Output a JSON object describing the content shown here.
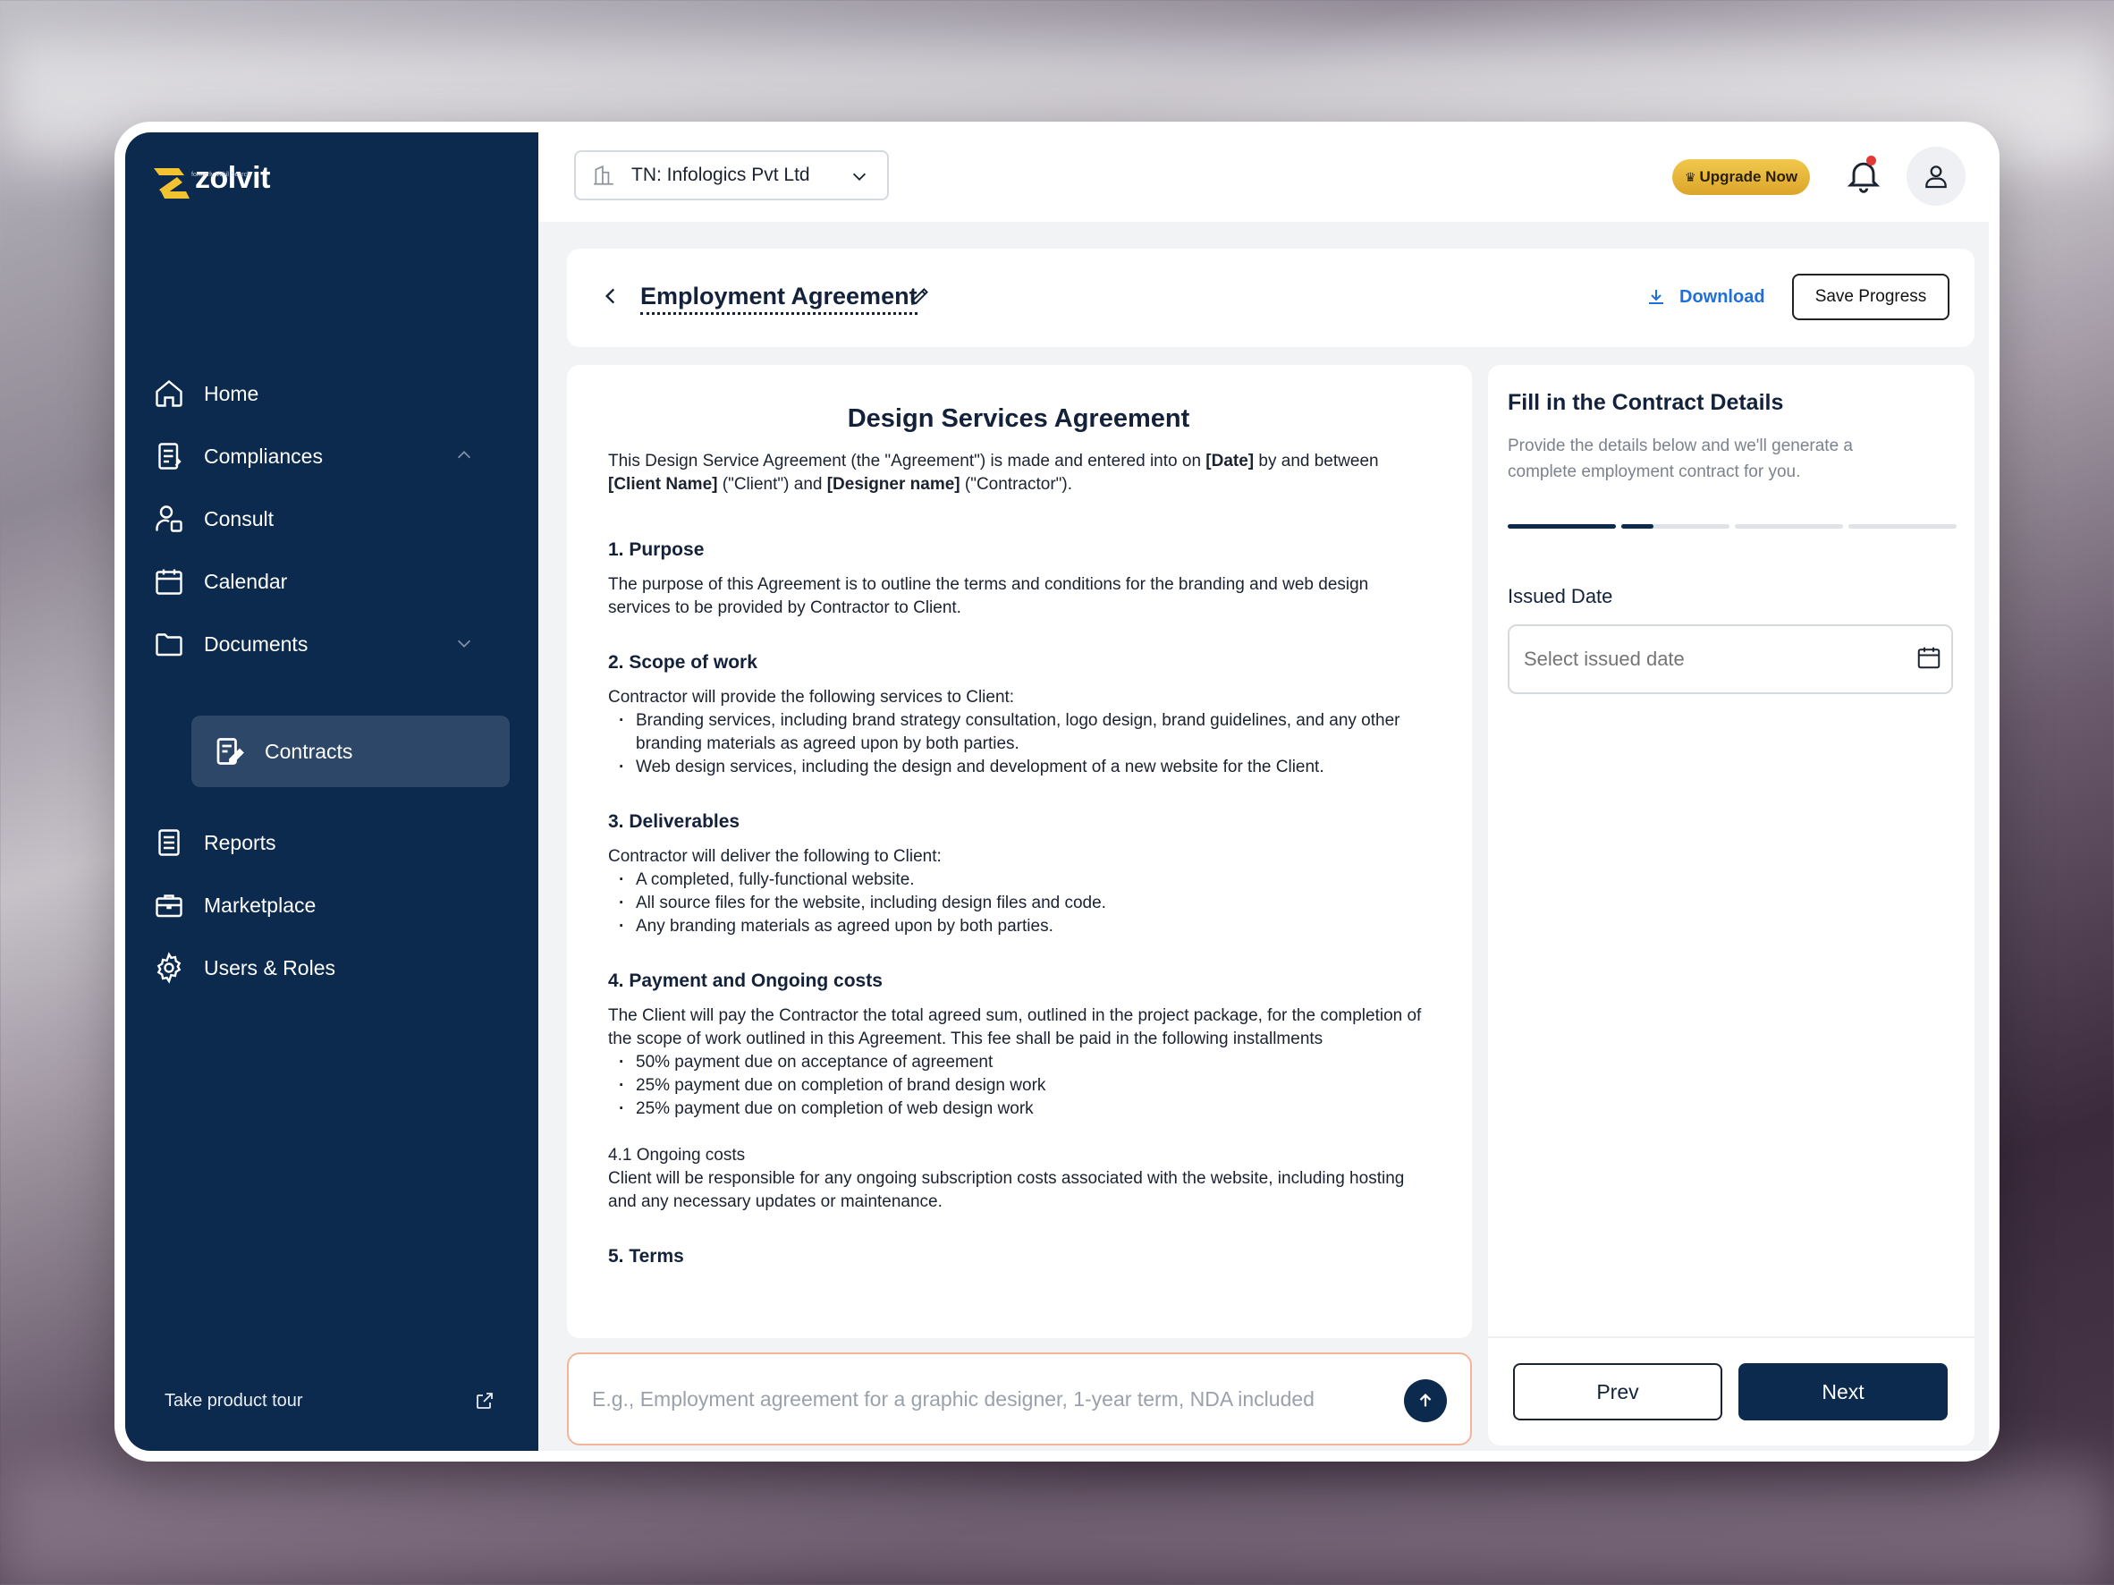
{
  "brand": {
    "name": "zolvit",
    "tagline": "formerly Vakil Search",
    "accent": "#f2c230",
    "primary": "#0b2a4d"
  },
  "sidebar": {
    "items": [
      {
        "label": "Home",
        "icon": "home-icon"
      },
      {
        "label": "Compliances",
        "icon": "clipboard-icon",
        "chevron": "chevron-up-icon"
      },
      {
        "label": "Consult",
        "icon": "consult-icon"
      },
      {
        "label": "Calendar",
        "icon": "calendar-icon"
      },
      {
        "label": "Documents",
        "icon": "folder-icon",
        "chevron": "chevron-down-icon"
      },
      {
        "label": "Reports",
        "icon": "report-icon"
      },
      {
        "label": "Marketplace",
        "icon": "briefcase-icon"
      },
      {
        "label": "Users & Roles",
        "icon": "gear-icon"
      }
    ],
    "sub_item": {
      "label": "Contracts",
      "icon": "contract-edit-icon"
    },
    "tour": {
      "label": "Take product tour",
      "icon": "external-link-icon"
    }
  },
  "topbar": {
    "company": "TN: Infologics Pvt Ltd",
    "upgrade_label": "Upgrade Now"
  },
  "header": {
    "title": "Employment Agreement",
    "download_label": "Download",
    "save_label": "Save Progress"
  },
  "document": {
    "title": "Design Services Agreement",
    "intro_a": "This Design Service Agreement (the \"Agreement\") is made and entered into on ",
    "intro_date": "[Date]",
    "intro_b": " by and between ",
    "intro_client": "[Client Name]",
    "intro_c": " (\"Client\") and ",
    "intro_designer": "[Designer name]",
    "intro_d": " (\"Contractor\").",
    "s1_title": "1. Purpose",
    "s1_text": "The purpose of this Agreement is to outline the terms and conditions for the branding and web design services to be provided by Contractor to Client.",
    "s2_title": "2. Scope of work",
    "s2_text": "Contractor will provide the following services to Client:",
    "s2_items": [
      "Branding services, including brand strategy consultation, logo design, brand guidelines, and any other branding materials as agreed upon by both parties.",
      "Web design services, including the design and development of a new website for the Client."
    ],
    "s3_title": "3. Deliverables",
    "s3_text": "Contractor will deliver the following to Client:",
    "s3_items": [
      "A completed, fully-functional website.",
      "All source files for the website, including design files and code.",
      "Any branding materials as agreed upon by both parties."
    ],
    "s4_title": "4. Payment and Ongoing costs",
    "s4_text": "The Client will pay the Contractor the total agreed sum, outlined in the project package, for the completion of the scope of work outlined in this Agreement. This fee shall be paid in the following installments",
    "s4_items": [
      "50% payment due on acceptance of agreement",
      "25% payment due on completion of brand design work",
      "25% payment due on completion of web design work"
    ],
    "s41_title": "4.1 Ongoing costs",
    "s41_text": "Client will be responsible for any ongoing subscription costs associated with the website, including hosting and any necessary updates or maintenance.",
    "s5_title": "5. Terms"
  },
  "prompt": {
    "placeholder": "E.g., Employment agreement for a graphic designer, 1-year term, NDA included"
  },
  "details": {
    "title": "Fill in the Contract Details",
    "description": "Provide the details below and we'll generate a complete employment contract for you.",
    "progress": {
      "total_steps": 4,
      "completed_steps": 1,
      "current_step_fraction": 0.3
    },
    "field_label": "Issued Date",
    "field_placeholder": "Select issued date",
    "prev_label": "Prev",
    "next_label": "Next"
  }
}
